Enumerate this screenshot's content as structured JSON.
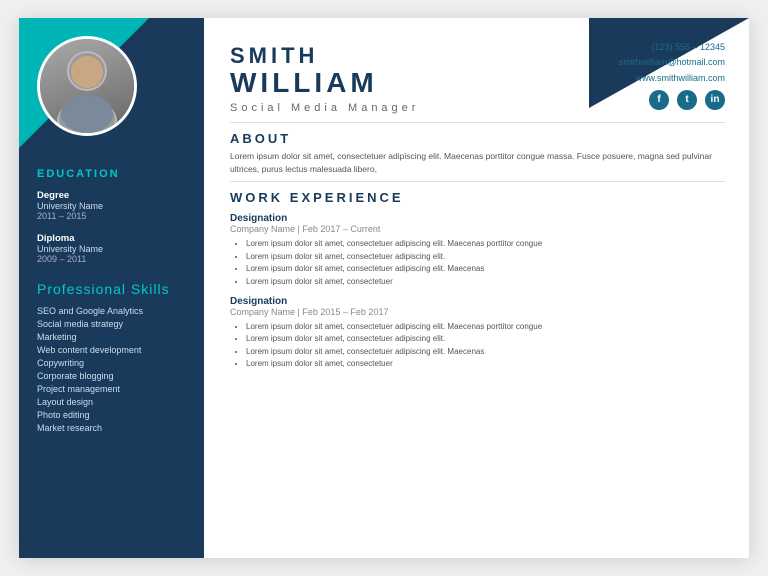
{
  "header": {
    "name_last": "SMITH",
    "name_first": "WILLIAM",
    "job_title": "Social Media Manager",
    "phone": "(123) 555 – 12345",
    "email": "smithwilliam@hotmail.com",
    "website": "www.smithwilliam.com"
  },
  "social": {
    "facebook": "f",
    "twitter": "t",
    "linkedin": "in"
  },
  "sidebar": {
    "education_title": "EDUCATION",
    "education": [
      {
        "degree": "Degree",
        "university": "University Name",
        "years": "2011 – 2015"
      },
      {
        "degree": "Diploma",
        "university": "University Name",
        "years": "2009 – 2011"
      }
    ],
    "skills_title": "Professional Skills",
    "skills": [
      "SEO and Google Analytics",
      "Social media strategy",
      "Marketing",
      "Web content development",
      "Copywriting",
      "Corporate blogging",
      "Project management",
      "Layout design",
      "Photo editing",
      "Market research"
    ]
  },
  "about": {
    "title": "ABOUT",
    "text": "Lorem ipsum dolor sit amet, consectetuer adipiscing elit. Maecenas porttitor congue massa. Fusce posuere, magna sed pulvinar ultrices, purus lectus malesuada libero,"
  },
  "work_experience": {
    "title": "WORK EXPERIENCE",
    "jobs": [
      {
        "designation": "Designation",
        "company": "Company Name",
        "period": "Feb 2017 – Current",
        "bullets": [
          "Lorem ipsum dolor sit amet, consectetuer adipiscing elit. Maecenas porttitor congue",
          "Lorem ipsum dolor sit amet, consectetuer adipiscing elit.",
          "Lorem ipsum dolor sit amet, consectetuer adipiscing elit. Maecenas",
          "Lorem ipsum dolor sit amet, consectetuer"
        ]
      },
      {
        "designation": "Designation",
        "company": "Company Name",
        "period": "Feb 2015 – Feb 2017",
        "bullets": [
          "Lorem ipsum dolor sit amet, consectetuer adipiscing elit. Maecenas porttitor congue",
          "Lorem ipsum dolor sit amet, consectetuer adipiscing elit.",
          "Lorem ipsum dolor sit amet, consectetuer adipiscing elit. Maecenas",
          "Lorem ipsum dolor sit amet, consectetuer"
        ]
      }
    ]
  }
}
